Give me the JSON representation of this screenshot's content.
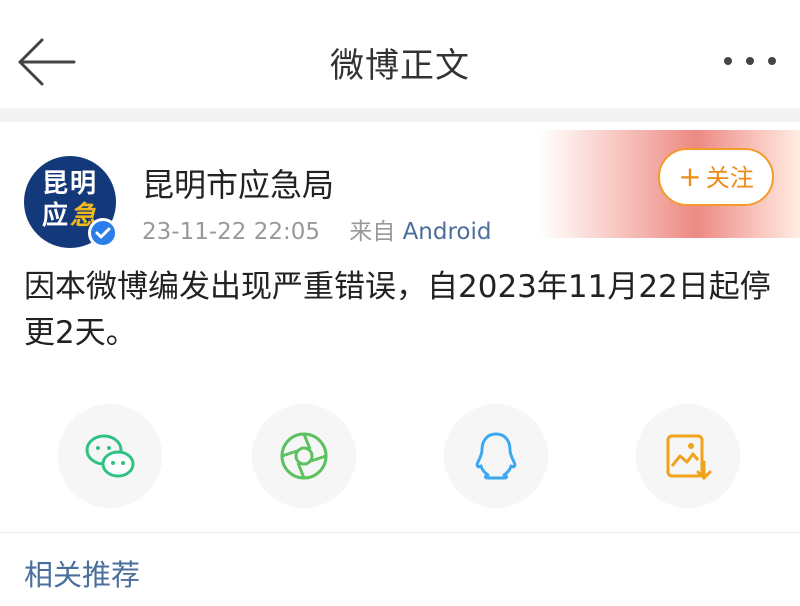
{
  "header": {
    "title": "微博正文"
  },
  "post": {
    "author": {
      "name": "昆明市应急局",
      "avatar_line1": "昆明",
      "avatar_line2_a": "应",
      "avatar_line2_b": "急"
    },
    "time": "23-11-22 22:05",
    "source_prefix": "来自",
    "source": "Android",
    "follow_label": "关注",
    "follow_plus": "+",
    "text": "因本微博编发出现严重错误，自2023年11月22日起停更2天。"
  },
  "share": {
    "icons": [
      "wechat-icon",
      "moments-icon",
      "qq-icon",
      "save-image-icon"
    ]
  },
  "related": {
    "label": "相关推荐"
  },
  "colors": {
    "accent": "#ef8a18",
    "link": "#4a6f9c",
    "wechat": "#2fc284",
    "moments": "#5cc15f",
    "qq": "#3aa9f0",
    "save": "#f0a21a"
  }
}
